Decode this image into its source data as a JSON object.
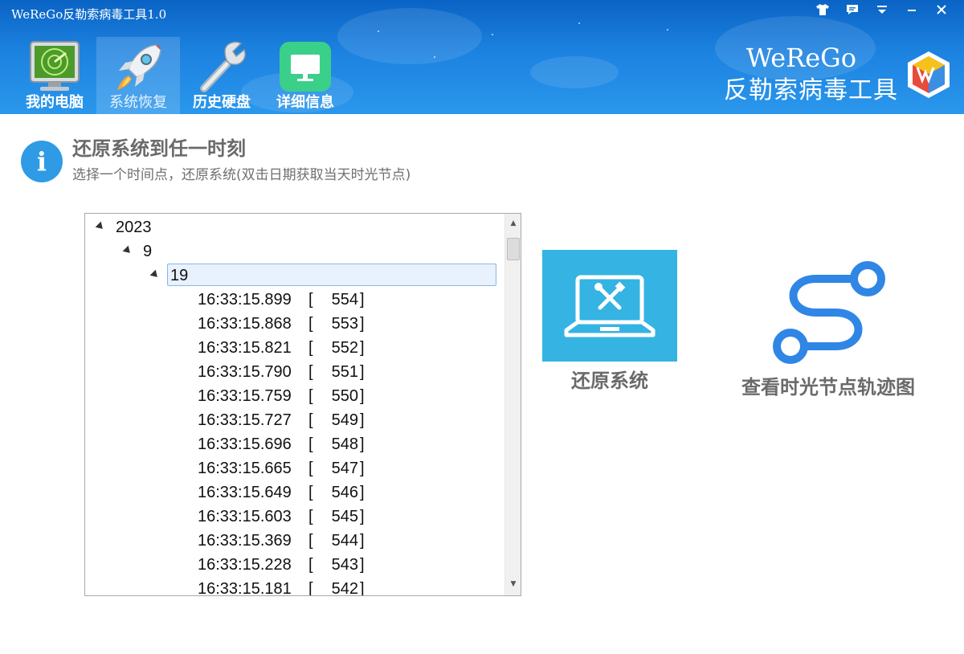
{
  "app": {
    "title": "WeReGo反勒索病毒工具1.0",
    "brand_en": "WeReGo",
    "brand_cn": "反勒索病毒工具"
  },
  "window_controls": [
    {
      "name": "skin-button",
      "icon": "shirt-icon"
    },
    {
      "name": "feedback-button",
      "icon": "chat-icon"
    },
    {
      "name": "menu-button",
      "icon": "menu-icon"
    },
    {
      "name": "minimize-button",
      "icon": "minimize-icon"
    },
    {
      "name": "close-button",
      "icon": "close-icon"
    }
  ],
  "nav": {
    "tabs": [
      {
        "label": "我的电脑",
        "icon": "radar-monitor-icon",
        "active": false
      },
      {
        "label": "系统恢复",
        "icon": "rocket-icon",
        "active": true
      },
      {
        "label": "历史硬盘",
        "icon": "wrench-icon",
        "active": false
      },
      {
        "label": "详细信息",
        "icon": "monitor-icon",
        "active": false
      }
    ]
  },
  "info": {
    "title": "还原系统到任一时刻",
    "subtitle": "选择一个时间点，还原系统(双击日期获取当天时光节点)"
  },
  "tree": {
    "year": "2023",
    "month": "9",
    "day": "19",
    "entries": [
      {
        "time": "16:33:15.899",
        "index": "554"
      },
      {
        "time": "16:33:15.868",
        "index": "553"
      },
      {
        "time": "16:33:15.821",
        "index": "552"
      },
      {
        "time": "16:33:15.790",
        "index": "551"
      },
      {
        "time": "16:33:15.759",
        "index": "550"
      },
      {
        "time": "16:33:15.727",
        "index": "549"
      },
      {
        "time": "16:33:15.696",
        "index": "548"
      },
      {
        "time": "16:33:15.665",
        "index": "547"
      },
      {
        "time": "16:33:15.649",
        "index": "546"
      },
      {
        "time": "16:33:15.603",
        "index": "545"
      },
      {
        "time": "16:33:15.369",
        "index": "544"
      },
      {
        "time": "16:33:15.228",
        "index": "543"
      },
      {
        "time": "16:33:15.181",
        "index": "542"
      }
    ],
    "bracket_open": "[",
    "bracket_close": "]"
  },
  "actions": {
    "restore_label": "还原系统",
    "timeline_label": "查看时光节点轨迹图"
  },
  "colors": {
    "header_top": "#0a63c4",
    "header_bottom": "#2a97ec",
    "restore_tile": "#35b3e3",
    "timeline_accent": "#2f86e5",
    "info_icon": "#2e9be4"
  }
}
